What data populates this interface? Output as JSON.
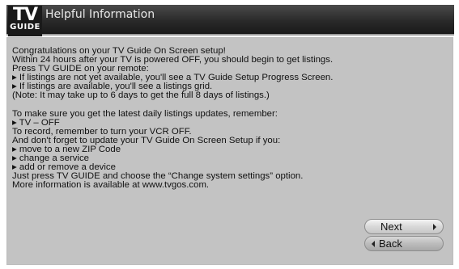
{
  "header": {
    "logo_top": "TV",
    "logo_bottom": "GUIDE",
    "title": "Helpful Information"
  },
  "body_lines": [
    "Congratulations on your TV Guide On Screen setup!",
    "Within 24 hours after your TV is powered OFF, you should begin to get listings.",
    "Press TV GUIDE on your remote:",
    "▸ If listings are not yet available, you'll see a TV Guide Setup Progress Screen.",
    "▸ If listings are available, you'll see a listings grid.",
    "(Note: It may take up to 6 days to get the full 8 days of listings.)",
    "",
    "To make sure you get the latest daily listings updates, remember:",
    "▸ TV – OFF",
    "To record, remember to turn your VCR OFF.",
    "And don't forget to update your TV Guide On Screen Setup if you:",
    "▸ move to a new ZIP Code",
    "▸ change a service",
    "▸ add or remove a device",
    "Just press TV GUIDE and choose the “Change system settings” option.",
    "More information is available at www.tvgos.com."
  ],
  "buttons": {
    "next_label": "Next",
    "back_label": "Back"
  },
  "icons": {
    "next": "triangle-right-icon",
    "back": "triangle-left-icon"
  }
}
